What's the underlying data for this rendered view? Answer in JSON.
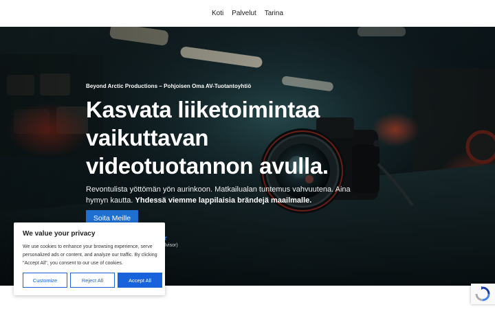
{
  "nav": {
    "items": [
      "Koti",
      "Palvelut",
      "Tarina"
    ]
  },
  "hero": {
    "kicker": "Beyond Arctic Productions – Pohjoisen Oma AV-Tuotantoyhtiö",
    "title_lines": [
      "Kasvata liiketoimintaa",
      "vaikuttavan",
      "videotuotannon avulla."
    ],
    "description": "Revontulista yöttömän yön aurinkoon. Matkailualan tuntemus vahvuutena. Aina hymyn kautta.",
    "description_bold": "Yhdessä viemme lappilaisia brändejä maailmalle.",
    "cta_label": "Soita Meille",
    "rating_tail": "lvisor)"
  },
  "cookie": {
    "title": "We value your privacy",
    "text": "We use cookies to enhance your browsing experience, serve personalized ads or content, and analyze our traffic. By clicking \"Accept All\", you consent to our use of cookies.",
    "customize_label": "Customize",
    "reject_label": "Reject All",
    "accept_label": "Accept All"
  },
  "icons": {
    "hero_photo": "camera-photo",
    "recaptcha": "recaptcha-icon",
    "star": "star-icon"
  },
  "colors": {
    "accent": "#1f6fd1",
    "cookie_accent": "#1863dc"
  }
}
